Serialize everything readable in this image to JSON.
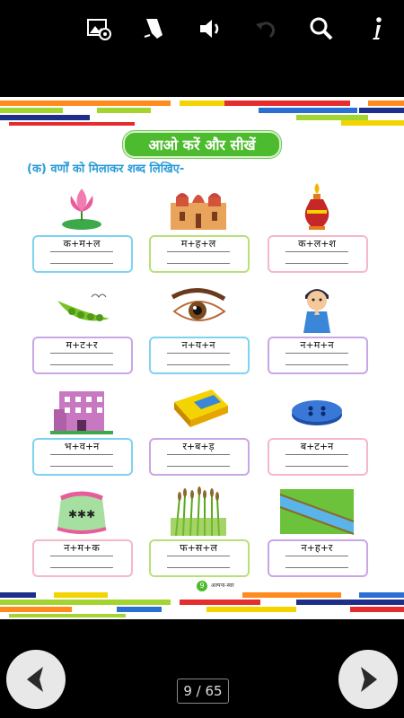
{
  "toolbar": {
    "icons": [
      "image-settings-icon",
      "bookmark-icon",
      "speaker-icon",
      "undo-icon",
      "search-icon",
      "info-icon"
    ]
  },
  "page": {
    "title": "आओ करें और सीखें",
    "instruction": "(क) वर्णों को मिलाकर शब्द लिखिए-",
    "cards": [
      {
        "word": "क+म+ल",
        "icon": "lotus-icon",
        "border": "#7fd3f0"
      },
      {
        "word": "म+ह+ल",
        "icon": "palace-icon",
        "border": "#b8e07a"
      },
      {
        "word": "क+ल+श",
        "icon": "kalash-icon",
        "border": "#f5b8c8"
      },
      {
        "word": "म+ट+र",
        "icon": "peas-icon",
        "border": "#c9a6e6"
      },
      {
        "word": "न+य+न",
        "icon": "eye-icon",
        "border": "#7fd3f0"
      },
      {
        "word": "न+म+न",
        "icon": "boy-namaste-icon",
        "border": "#c9a6e6"
      },
      {
        "word": "भ+व+न",
        "icon": "building-icon",
        "border": "#7fd3f0"
      },
      {
        "word": "र+ब+ड़",
        "icon": "eraser-icon",
        "border": "#c9a6e6"
      },
      {
        "word": "ब+ट+न",
        "icon": "button-icon",
        "border": "#f5b8c8"
      },
      {
        "word": "न+म+क",
        "icon": "salt-bag-icon",
        "border": "#f5b8c8"
      },
      {
        "word": "फ+स+ल",
        "icon": "crop-icon",
        "border": "#b8e07a"
      },
      {
        "word": "न+ह+र",
        "icon": "canal-icon",
        "border": "#c9a6e6"
      }
    ],
    "footer_number": "9",
    "footer_text": "अल्पना-स्वर"
  },
  "nav": {
    "counter": "9 / 65"
  }
}
